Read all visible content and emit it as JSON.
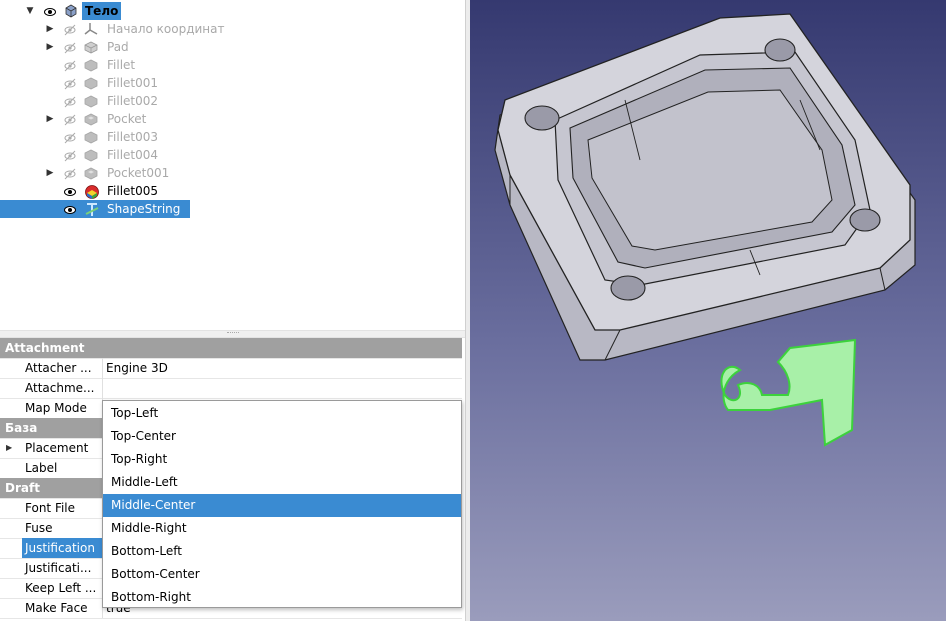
{
  "tree": {
    "items": [
      {
        "label": "Тело",
        "state": "active",
        "expander": "expanded",
        "eye": "visible",
        "icon": "body-icon"
      },
      {
        "label": "Начало координат",
        "state": "dim",
        "expander": "collapsed",
        "eye": "hidden",
        "icon": "origin-icon"
      },
      {
        "label": "Pad",
        "state": "dim",
        "expander": "collapsed",
        "eye": "hidden",
        "icon": "pad-icon"
      },
      {
        "label": "Fillet",
        "state": "dim",
        "expander": "none",
        "eye": "hidden",
        "icon": "fillet-icon"
      },
      {
        "label": "Fillet001",
        "state": "dim",
        "expander": "none",
        "eye": "hidden",
        "icon": "fillet-icon"
      },
      {
        "label": "Fillet002",
        "state": "dim",
        "expander": "none",
        "eye": "hidden",
        "icon": "fillet-icon"
      },
      {
        "label": "Pocket",
        "state": "dim",
        "expander": "collapsed",
        "eye": "hidden",
        "icon": "pocket-icon"
      },
      {
        "label": "Fillet003",
        "state": "dim",
        "expander": "none",
        "eye": "hidden",
        "icon": "fillet-icon"
      },
      {
        "label": "Fillet004",
        "state": "dim",
        "expander": "none",
        "eye": "hidden",
        "icon": "fillet-icon"
      },
      {
        "label": "Pocket001",
        "state": "dim",
        "expander": "collapsed",
        "eye": "hidden",
        "icon": "pocket-icon"
      },
      {
        "label": "Fillet005",
        "state": "normal",
        "expander": "none",
        "eye": "visible",
        "icon": "fillet-tip-icon"
      },
      {
        "label": "ShapeString",
        "state": "selected",
        "expander": "none",
        "eye": "visible",
        "icon": "shapestring-icon"
      }
    ]
  },
  "properties": {
    "rows": [
      {
        "type": "group",
        "label": "Attachment"
      },
      {
        "type": "prop",
        "name": "Attacher ...",
        "value": "Engine 3D"
      },
      {
        "type": "prop",
        "name": "Attachme...",
        "value": ""
      },
      {
        "type": "prop",
        "name": "Map Mode",
        "value": ""
      },
      {
        "type": "group",
        "label": "База"
      },
      {
        "type": "prop",
        "name": "Placement",
        "value": "",
        "expandable": true
      },
      {
        "type": "prop",
        "name": "Label",
        "value": ""
      },
      {
        "type": "group",
        "label": "Draft"
      },
      {
        "type": "prop",
        "name": "Font File",
        "value": ""
      },
      {
        "type": "prop",
        "name": "Fuse",
        "value": ""
      },
      {
        "type": "prop",
        "name": "Justification",
        "value": "",
        "selected": true
      },
      {
        "type": "prop",
        "name": "Justificati...",
        "value": ""
      },
      {
        "type": "prop",
        "name": "Keep Left ...",
        "value": ""
      },
      {
        "type": "prop",
        "name": "Make Face",
        "value": "true"
      }
    ]
  },
  "dropdown": {
    "options": [
      "Top-Left",
      "Top-Center",
      "Top-Right",
      "Middle-Left",
      "Middle-Center",
      "Middle-Right",
      "Bottom-Left",
      "Bottom-Center",
      "Bottom-Right"
    ],
    "selected": "Middle-Center"
  },
  "colors": {
    "selection": "#3a8bd2",
    "shapestring_fill": "#a8f0a8",
    "shapestring_outline": "#3cd23c",
    "model_face": "#d4d4dc"
  }
}
